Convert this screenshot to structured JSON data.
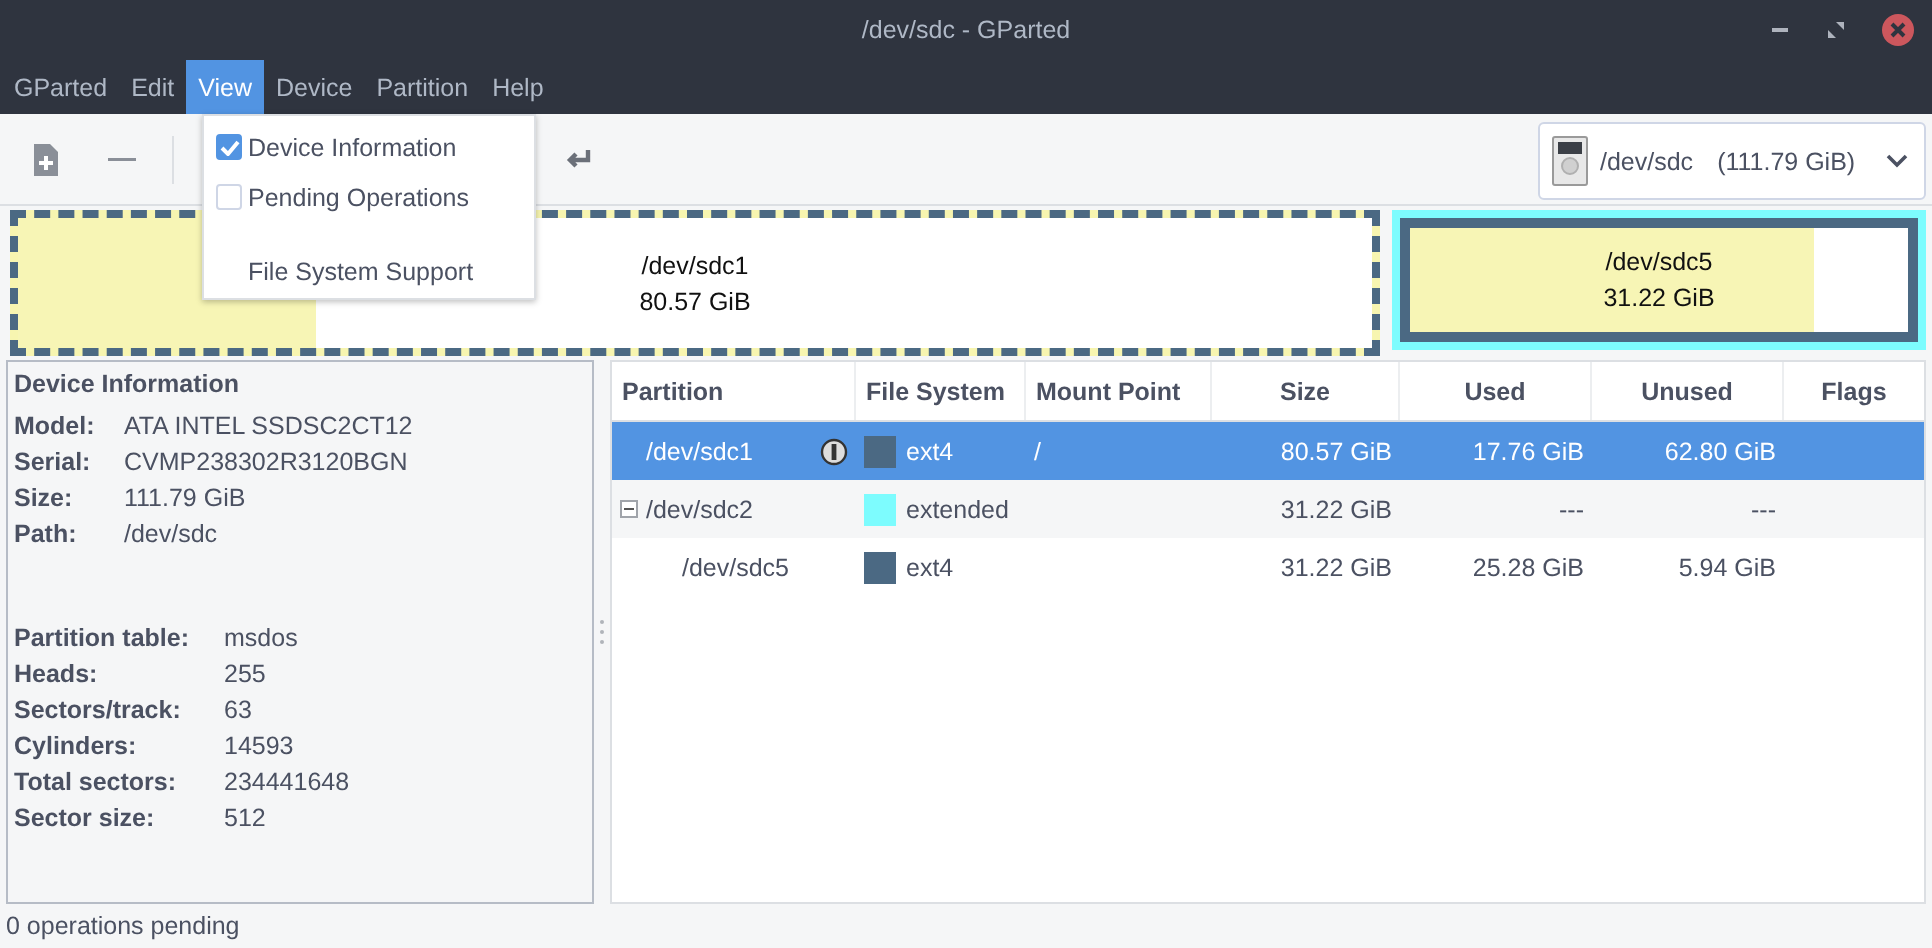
{
  "window": {
    "title": "/dev/sdc - GParted"
  },
  "menu_bar": [
    {
      "label": "GParted",
      "selected": false
    },
    {
      "label": "Edit",
      "selected": false
    },
    {
      "label": "View",
      "selected": true
    },
    {
      "label": "Device",
      "selected": false
    },
    {
      "label": "Partition",
      "selected": false
    },
    {
      "label": "Help",
      "selected": false
    }
  ],
  "view_menu": [
    {
      "kind": "check",
      "label": "Device Information",
      "checked": true
    },
    {
      "kind": "check",
      "label": "Pending Operations",
      "checked": false
    },
    {
      "kind": "item",
      "label": "File System Support"
    }
  ],
  "device_selector": {
    "device": "/dev/sdc",
    "size": "(111.79 GiB)"
  },
  "disk_map": [
    {
      "kind": "partition",
      "name": "/dev/sdc1",
      "size": "80.57 GiB",
      "selected": true,
      "level": 0.22,
      "color": "#4b6983"
    },
    {
      "kind": "extended",
      "color": "#7dfcfe",
      "children": [
        {
          "name": "/dev/sdc5",
          "size": "31.22 GiB",
          "selected": false,
          "level": 0.81,
          "color": "#4b6983"
        }
      ]
    }
  ],
  "device_information": {
    "title": "Device Information",
    "groups": [
      [
        {
          "label": "Model:",
          "value": "ATA INTEL SSDSC2CT12"
        },
        {
          "label": "Serial:",
          "value": "CVMP238302R3120BGN"
        },
        {
          "label": "Size:",
          "value": "111.79 GiB"
        },
        {
          "label": "Path:",
          "value": "/dev/sdc"
        }
      ],
      [
        {
          "label": "Partition table:",
          "value": "msdos"
        },
        {
          "label": "Heads:",
          "value": "255"
        },
        {
          "label": "Sectors/track:",
          "value": "63"
        },
        {
          "label": "Cylinders:",
          "value": "14593"
        },
        {
          "label": "Total sectors:",
          "value": "234441648"
        },
        {
          "label": "Sector size:",
          "value": "512"
        }
      ]
    ]
  },
  "table": {
    "columns": [
      "Partition",
      "File System",
      "Mount Point",
      "Size",
      "Used",
      "Unused",
      "Flags"
    ],
    "rows": [
      {
        "partition": "/dev/sdc1",
        "mounted": true,
        "file_system": "ext4",
        "color": "#4b6983",
        "mount_point": "/",
        "size": "80.57 GiB",
        "used": "17.76 GiB",
        "unused": "62.80 GiB",
        "selected": true
      },
      {
        "partition": "/dev/sdc2",
        "expanded": true,
        "file_system": "extended",
        "color": "#7dfcfe",
        "size": "31.22 GiB",
        "used": "---",
        "unused": "---",
        "selected": false,
        "children": [
          {
            "partition": "/dev/sdc5",
            "file_system": "ext4",
            "color": "#4b6983",
            "size": "31.22 GiB",
            "used": "25.28 GiB",
            "unused": "5.94 GiB",
            "selected": false
          }
        ]
      }
    ]
  },
  "status_bar": "0 operations pending"
}
